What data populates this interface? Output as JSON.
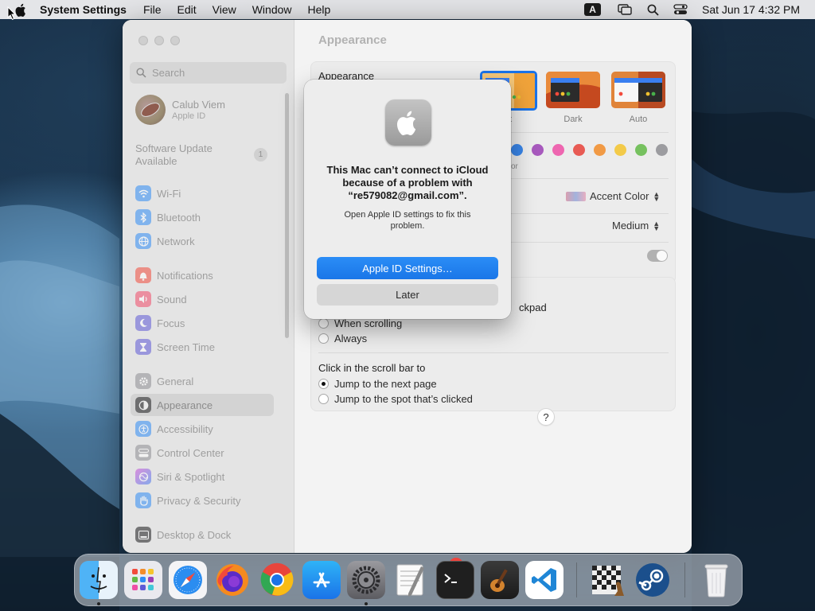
{
  "menubar": {
    "app_name": "System Settings",
    "menus": [
      "File",
      "Edit",
      "View",
      "Window",
      "Help"
    ],
    "input_source": "A",
    "clock": "Sat Jun 17  4:32 PM"
  },
  "sidebar": {
    "search_placeholder": "Search",
    "user": {
      "name": "Calub Viem",
      "subtitle": "Apple ID"
    },
    "update": {
      "line1": "Software Update",
      "line2": "Available",
      "badge": "1"
    },
    "items": [
      {
        "label": "Wi-Fi",
        "icon": "wifi-icon",
        "color": "#2f8cf5"
      },
      {
        "label": "Bluetooth",
        "icon": "bluetooth-icon",
        "color": "#2f8cf5"
      },
      {
        "label": "Network",
        "icon": "network-icon",
        "color": "#2f8cf5"
      },
      {
        "label": "Notifications",
        "icon": "bell-icon",
        "color": "#f24a3c"
      },
      {
        "label": "Sound",
        "icon": "speaker-icon",
        "color": "#f24a6a"
      },
      {
        "label": "Focus",
        "icon": "moon-icon",
        "color": "#5e5ad6"
      },
      {
        "label": "Screen Time",
        "icon": "hourglass-icon",
        "color": "#5e5ad6"
      },
      {
        "label": "General",
        "icon": "gear-icon",
        "color": "#8e8e93"
      },
      {
        "label": "Appearance",
        "icon": "appearance-icon",
        "color": "#1c1c1e"
      },
      {
        "label": "Accessibility",
        "icon": "accessibility-icon",
        "color": "#2f8cf5"
      },
      {
        "label": "Control Center",
        "icon": "control-center-icon",
        "color": "#8e8e93"
      },
      {
        "label": "Siri & Spotlight",
        "icon": "siri-icon",
        "color": "#b04ad6"
      },
      {
        "label": "Privacy & Security",
        "icon": "hand-icon",
        "color": "#2f8cf5"
      },
      {
        "label": "Desktop & Dock",
        "icon": "dock-icon",
        "color": "#1c1c1e"
      }
    ],
    "selected": "Appearance"
  },
  "main": {
    "title": "Appearance",
    "appearance_label": "Appearance",
    "modes": [
      {
        "label": "Light",
        "visible_label": "ht"
      },
      {
        "label": "Dark",
        "visible_label": "Dark"
      },
      {
        "label": "Auto",
        "visible_label": "Auto"
      }
    ],
    "accent_colors": [
      "#1a73e8",
      "#9b3fb5",
      "#ef4fa6",
      "#e7423a",
      "#f28c28",
      "#f5c42d",
      "#62ba46",
      "#8e8e93"
    ],
    "accent_caption_fragment": "or",
    "highlight_popup": "Accent Color",
    "sidebar_icon_size": "Medium",
    "scroll_section_fragment": "ckpad",
    "scroll_options": [
      {
        "label": "When scrolling",
        "checked": false
      },
      {
        "label": "Always",
        "checked": false
      }
    ],
    "click_label": "Click in the scroll bar to",
    "click_options": [
      {
        "label": "Jump to the next page",
        "checked": true
      },
      {
        "label": "Jump to the spot that’s clicked",
        "checked": false
      }
    ],
    "help": "?"
  },
  "alert": {
    "title": "This Mac can’t connect to iCloud because of a problem with “re579082@gmail.com”.",
    "message": "Open Apple ID settings to fix this problem.",
    "primary_button": "Apple ID Settings…",
    "secondary_button": "Later"
  },
  "dock": {
    "apps": [
      "Finder",
      "Launchpad",
      "Safari",
      "Firefox",
      "Chrome",
      "App Store",
      "System Settings",
      "TextEdit",
      "Terminal",
      "GarageBand",
      "Visual Studio Code",
      "Chess",
      "Steam",
      "Trash"
    ],
    "system_settings_badge": "1"
  }
}
